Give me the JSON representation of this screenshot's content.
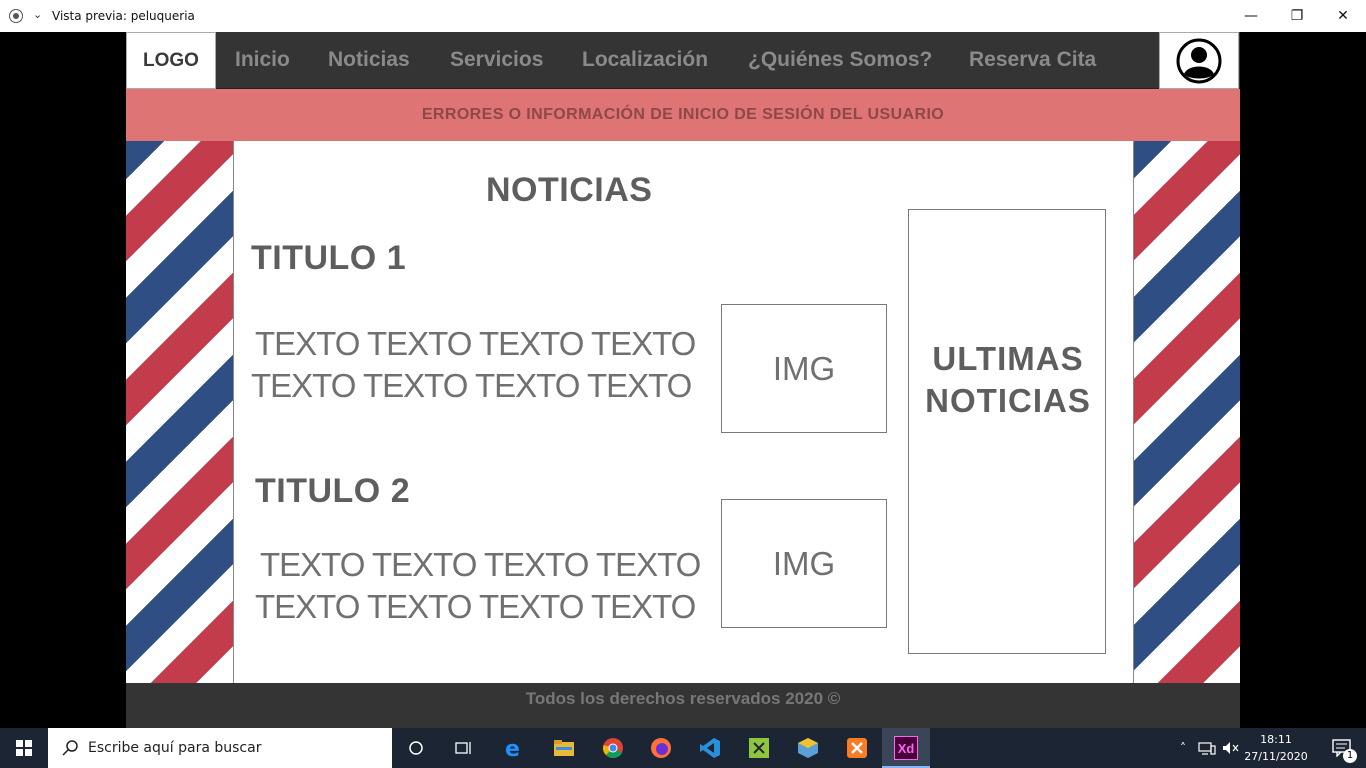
{
  "window": {
    "title": "Vista previa: peluqueria",
    "minimize": "—",
    "restore": "❐",
    "close": "✕"
  },
  "nav": {
    "logo": "LOGO",
    "items": [
      "Inicio",
      "Noticias",
      "Servicios",
      "Localización",
      "¿Quiénes Somos?",
      "Reserva Cita"
    ],
    "user_icon": "user-avatar-icon"
  },
  "banner": {
    "text": "ERRORES O INFORMACIÓN DE INICIO DE SESIÓN DEL USUARIO"
  },
  "main": {
    "title": "NOTICIAS",
    "posts": [
      {
        "title": "TITULO 1",
        "line1": "TEXTO TEXTO TEXTO TEXTO",
        "line2": "TEXTO TEXTO TEXTO TEXTO",
        "image": "IMG"
      },
      {
        "title": "TITULO 2",
        "line1": "TEXTO TEXTO TEXTO TEXTO",
        "line2": "TEXTO TEXTO TEXTO TEXTO",
        "image": "IMG"
      }
    ],
    "sidebar": {
      "line1": "ULTIMAS",
      "line2": "NOTICIAS"
    }
  },
  "footer": {
    "text": "Todos los derechos reservados 2020 ©"
  },
  "taskbar": {
    "search_placeholder": "Escribe aquí para buscar",
    "time": "18:11",
    "date": "27/11/2020",
    "notifications": "1",
    "apps": [
      "cortana",
      "task-view",
      "edge",
      "file-explorer",
      "chrome",
      "firefox",
      "vscode",
      "sniptool",
      "virtualbox",
      "xampp",
      "adobe-xd"
    ],
    "xd_label": "Xd"
  },
  "colors": {
    "nav_bg": "#343434",
    "banner_bg": "#df7474",
    "stripe_red": "#c23c4c",
    "stripe_blue": "#2f4f84",
    "taskbar_bg": "#1c2533"
  }
}
